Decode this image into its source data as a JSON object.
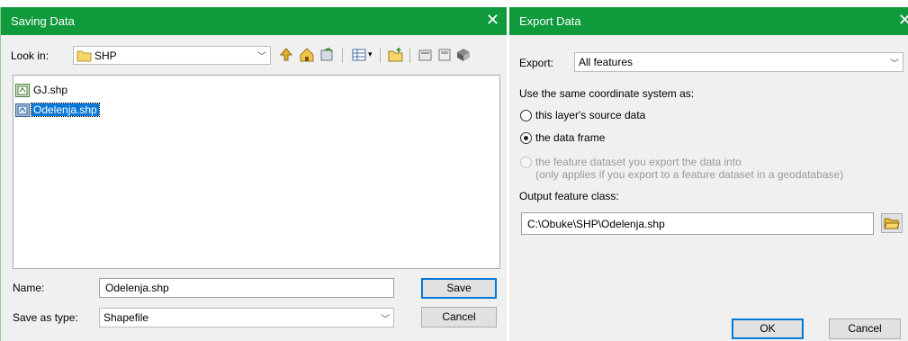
{
  "saving_dialog": {
    "title": "Saving Data",
    "look_in_label": "Look in:",
    "look_in_value": "SHP",
    "files": [
      {
        "name": "GJ.shp"
      },
      {
        "name": "Odelenja.shp"
      }
    ],
    "name_label": "Name:",
    "name_value": "Odelenja.shp",
    "save_as_type_label": "Save as type:",
    "save_as_type_value": "Shapefile",
    "save_button": "Save",
    "cancel_button": "Cancel"
  },
  "export_dialog": {
    "title": "Export Data",
    "export_label": "Export:",
    "export_value": "All features",
    "coord_heading": "Use the same coordinate system as:",
    "options": {
      "source": "this layer's source data",
      "frame": "the data frame",
      "dataset_line1": "the feature dataset you export the data into",
      "dataset_line2": "(only applies if you export to a feature dataset in a geodatabase)"
    },
    "selected_option": "the data frame",
    "output_label": "Output feature class:",
    "output_value": "C:\\Obuke\\SHP\\Odelenja.shp",
    "ok_button": "OK",
    "cancel_button": "Cancel"
  },
  "colors": {
    "titlebar": "#0f9a3c",
    "selection": "#0a78d7",
    "default_button_border": "#0078d7"
  },
  "icons": {
    "close": "close-icon",
    "folder": "folder-icon",
    "up": "up-one-level-icon",
    "home": "home-icon",
    "catalog": "catalog-icon",
    "views": "details-view-icon",
    "new_folder": "new-folder-icon",
    "browse": "open-folder-icon",
    "shapefile": "shapefile-icon"
  }
}
